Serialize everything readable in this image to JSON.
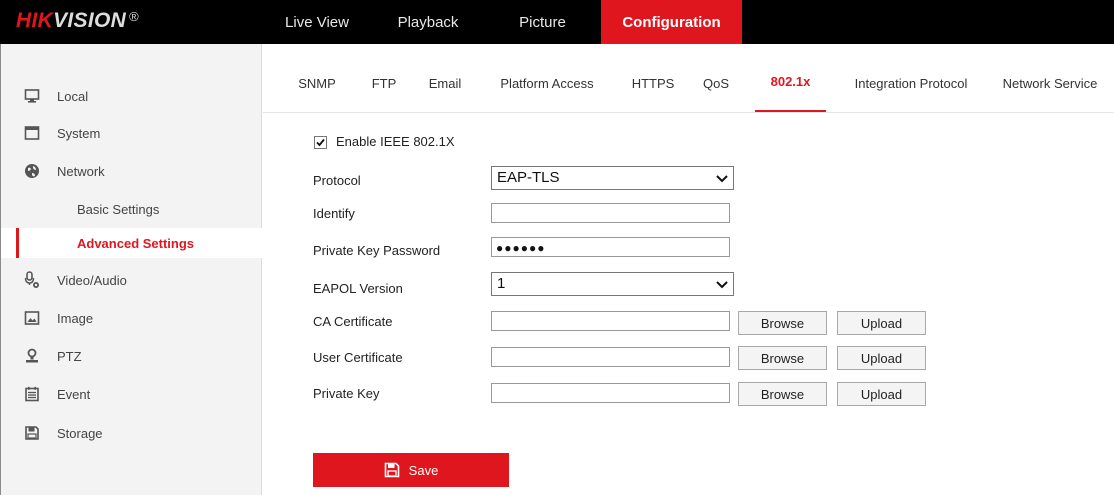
{
  "brand": {
    "logo_red": "HIK",
    "logo_grey": "VISION",
    "logo_mark": "®"
  },
  "top_nav": [
    {
      "label": "Live View"
    },
    {
      "label": "Playback"
    },
    {
      "label": "Picture"
    },
    {
      "label": "Configuration",
      "active": true
    }
  ],
  "sidebar": {
    "items": [
      {
        "label": "Local",
        "icon": "monitor-icon"
      },
      {
        "label": "System",
        "icon": "window-icon"
      },
      {
        "label": "Network",
        "icon": "globe-icon"
      },
      {
        "label": "Basic Settings",
        "sub": true
      },
      {
        "label": "Advanced Settings",
        "sub": true,
        "active": true
      },
      {
        "label": "Video/Audio",
        "icon": "mic-camera-icon"
      },
      {
        "label": "Image",
        "icon": "image-icon"
      },
      {
        "label": "PTZ",
        "icon": "ptz-icon"
      },
      {
        "label": "Event",
        "icon": "calendar-icon"
      },
      {
        "label": "Storage",
        "icon": "floppy-icon"
      }
    ]
  },
  "tabs": [
    {
      "label": "SNMP"
    },
    {
      "label": "FTP"
    },
    {
      "label": "Email"
    },
    {
      "label": "Platform Access"
    },
    {
      "label": "HTTPS"
    },
    {
      "label": "QoS"
    },
    {
      "label": "802.1x",
      "active": true
    },
    {
      "label": "Integration Protocol"
    },
    {
      "label": "Network Service"
    }
  ],
  "form": {
    "enable_label": "Enable IEEE 802.1X",
    "enable_checked": true,
    "protocol_label": "Protocol",
    "protocol_value": "EAP-TLS",
    "identify_label": "Identify",
    "identify_value": "",
    "private_key_password_label": "Private Key Password",
    "private_key_password_mask": "●●●●●●",
    "eapol_label": "EAPOL Version",
    "eapol_value": "1",
    "ca_cert_label": "CA Certificate",
    "user_cert_label": "User Certificate",
    "private_key_label": "Private Key",
    "browse_label": "Browse",
    "upload_label": "Upload",
    "save_label": "Save"
  },
  "colors": {
    "accent": "#e0161e",
    "topbar": "#000000",
    "sidebar_bg": "#f3f3f3"
  }
}
